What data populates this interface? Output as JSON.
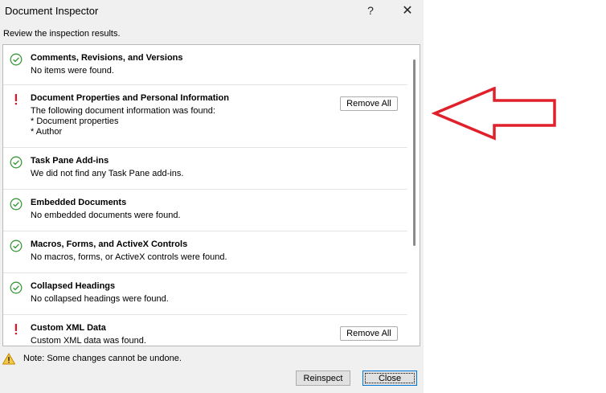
{
  "window": {
    "title": "Document Inspector",
    "help_label": "?",
    "close_label": "✕"
  },
  "subtitle": "Review the inspection results.",
  "results": [
    {
      "status": "ok",
      "name": "Comments, Revisions, and Versions",
      "desc": [
        "No items were found."
      ],
      "action": ""
    },
    {
      "status": "warn",
      "name": "Document Properties and Personal Information",
      "desc": [
        "The following document information was found:",
        "* Document properties",
        "* Author"
      ],
      "action": "Remove All"
    },
    {
      "status": "ok",
      "name": "Task Pane Add-ins",
      "desc": [
        "We did not find any Task Pane add-ins."
      ],
      "action": ""
    },
    {
      "status": "ok",
      "name": "Embedded Documents",
      "desc": [
        "No embedded documents were found."
      ],
      "action": ""
    },
    {
      "status": "ok",
      "name": "Macros, Forms, and ActiveX Controls",
      "desc": [
        "No macros, forms, or ActiveX controls were found."
      ],
      "action": ""
    },
    {
      "status": "ok",
      "name": "Collapsed Headings",
      "desc": [
        "No collapsed headings were found."
      ],
      "action": ""
    },
    {
      "status": "warn",
      "name": "Custom XML Data",
      "desc": [
        "Custom XML data was found."
      ],
      "action": "Remove All"
    }
  ],
  "note": "Note: Some changes cannot be undone.",
  "buttons": {
    "reinspect": "Reinspect",
    "close": "Close"
  },
  "colors": {
    "ok": "#3c9a3c",
    "warn": "#e81123",
    "arrow": "#e0202a"
  }
}
